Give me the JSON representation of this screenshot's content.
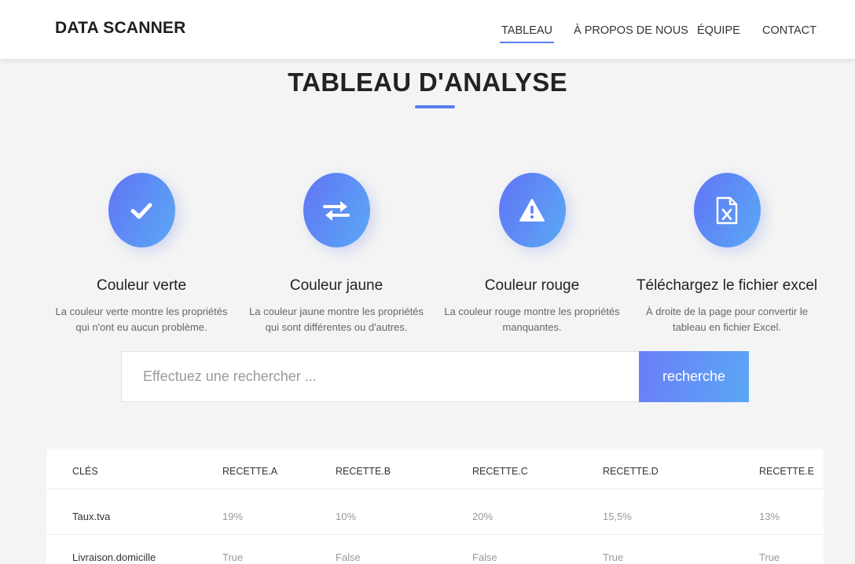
{
  "navbar": {
    "brand": "DATA SCANNER",
    "items": [
      {
        "label": "TABLEAU",
        "active": true
      },
      {
        "label": "À PROPOS DE NOUS",
        "active": false
      },
      {
        "label": "ÉQUIPE",
        "active": false
      },
      {
        "label": "CONTACT",
        "active": false
      }
    ]
  },
  "page": {
    "title": "TABLEAU D'ANALYSE"
  },
  "features": [
    {
      "icon": "check-icon",
      "title": "Couleur verte",
      "desc_line1": "La couleur verte montre les propriétés",
      "desc_line2": "qui n'ont eu aucun problème."
    },
    {
      "icon": "swap-arrows-icon",
      "title": "Couleur jaune",
      "desc_line1": "La couleur jaune montre les propriétés",
      "desc_line2": "qui sont différentes ou d'autres."
    },
    {
      "icon": "warning-icon",
      "title": "Couleur rouge",
      "desc_line1": "La couleur rouge montre les propriétés",
      "desc_line2": "manquantes."
    },
    {
      "icon": "excel-file-icon",
      "title": "Téléchargez le fichier excel",
      "desc_line1": "À droite de la page pour convertir le",
      "desc_line2": "tableau en fichier Excel."
    }
  ],
  "search": {
    "placeholder": "Effectuez une rechercher ...",
    "value": "",
    "button_label": "recherche"
  },
  "table": {
    "headers": [
      "CLÉS",
      "RECETTE.A",
      "RECETTE.B",
      "RECETTE.C",
      "RECETTE.D",
      "RECETTE.E"
    ],
    "rows": [
      [
        "Taux.tva",
        "19%",
        "10%",
        "20%",
        "15,5%",
        "13%"
      ],
      [
        "Livraison.domicille",
        "True",
        "False",
        "False",
        "True",
        "True"
      ]
    ]
  },
  "colors": {
    "accent": "#5a7df0",
    "gradient_start": "#6174f5",
    "gradient_end": "#5aa9f5"
  }
}
